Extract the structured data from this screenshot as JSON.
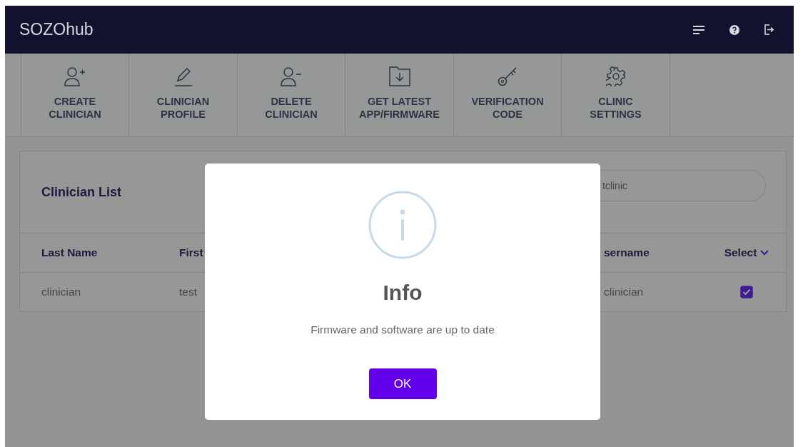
{
  "header": {
    "title": "SOZOhub"
  },
  "toolbar": [
    {
      "label": "CREATE CLINICIAN"
    },
    {
      "label": "CLINICIAN PROFILE"
    },
    {
      "label": "DELETE CLINICIAN"
    },
    {
      "label": "GET LATEST APP/FIRMWARE"
    },
    {
      "label": "VERIFICATION CODE"
    },
    {
      "label": "CLINIC SETTINGS"
    }
  ],
  "clinician_list": {
    "title": "Clinician List",
    "search": {
      "value": "tclinic"
    },
    "columns": [
      "Last Name",
      "First",
      "sername",
      "Select"
    ],
    "rows": [
      {
        "cells": [
          "clinician",
          "test",
          "clinician"
        ],
        "checked": true
      }
    ]
  },
  "dialog": {
    "title": "Info",
    "message": "Firmware and software are up to date",
    "button": "OK"
  }
}
